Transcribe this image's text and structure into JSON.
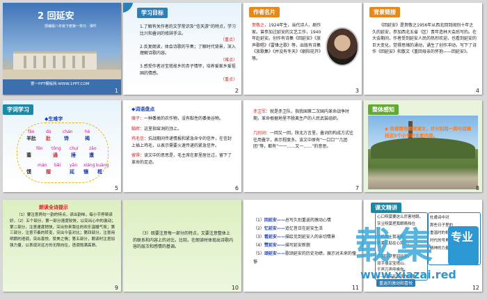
{
  "s1": {
    "title": "2 回延安",
    "caption": "部编版八年级下册第一单元 · 课件",
    "footer": "第一PPT模板网-WWW.1PPT.COM",
    "num": "1"
  },
  "s2": {
    "tag": "学习目标",
    "lines": [
      "1.了解有关作者的文学常识及“信天游”的特点，学习比兴和叠词的修辞手法。",
      "（重点）",
      "2.反复朗读，体会诗歌的节奏；了解时代背景，深入理解诗歌内容。",
      "（难点）",
      "3.感受作者对宝塔故乡的赤子情怀，培养爱家乡爱祖国的情感。",
      "（重点）"
    ],
    "num": "2"
  },
  "s3": {
    "tag": "作者名片",
    "name": "贺敬之，",
    "text": "1924年生，当代诗人、剧作家。曾参加过延安的文艺工作，1940年赴延安。创作有诗集《回延安》《放声歌唱》《雷锋之歌》等，出版有诗集《放歌集》《并没有冬天》《朝阳花开》等。",
    "num": "3"
  },
  "s4": {
    "tag": "背景链接",
    "text": "《回延安》是贺敬之1956年从西北回到阔别十年之久的延安，参加西北五省（区）青年造林大会后写的。在大会期间，作者受到延安人民的热烈欢迎，也看到延安的巨大变化，觉得思绪的涌动，诵生了创作冲动，写下了诗作《回延安》和散文《重回母亲的怀抱——回延安》。",
    "num": "4"
  },
  "s5": {
    "tag": "字词学习",
    "head": "◆生难字",
    "items": [
      {
        "py": "fǎo",
        "ch": "羊肚"
      },
      {
        "py": "dù",
        "ch": "肚"
      },
      {
        "py": "chán",
        "ch": "馋"
      },
      {
        "py": "hè",
        "ch": "褐"
      },
      {
        "py": "fēn",
        "ch": "蔫"
      },
      {
        "py": "tōnɡ",
        "ch": "通"
      },
      {
        "py": "chuí",
        "ch": "捶"
      },
      {
        "py": "zāo",
        "ch": "遭"
      },
      {
        "py": "mán",
        "ch": "馍"
      },
      {
        "py": "bǎi",
        "ch": "摆"
      },
      {
        "py": "yān",
        "ch": "延"
      },
      {
        "py": "xiánɡ",
        "ch": "镶"
      },
      {
        "py": "kuànɡ",
        "ch": "框"
      }
    ],
    "num": "5"
  },
  "s6": {
    "tag": "◆词语盘点",
    "items": [
      {
        "w": "糜子：",
        "d": "一种黍类的农作物，没有黏性的黍类谷物。"
      },
      {
        "w": "脑畔：",
        "d": "这里指窑洞的顶上。"
      },
      {
        "w": "鸡毛信：",
        "d": "抗战期间传递情报和紧急命令的信件，在信封上插上鸡毛，以表示需要火速传递的紧急信件。"
      },
      {
        "w": "留得：",
        "d": "读文中的意思是，毛主席在那里居住过，留下了革命的足迹。"
      }
    ],
    "num": "6"
  },
  "s7": {
    "items": [
      {
        "w": "赤卫军：",
        "d": "就是赤卫队，指我国第二次国内革命战争时期，革命根据地里不脱离生产的人民武装组织。"
      },
      {
        "w": "几则词：",
        "d": "一回又一回，陕北方言里，叠词的构成方式往往用叠字，表示程度多。该文中原有“一口口”“几团团”等，都有“一一……又一……”的意思。"
      }
    ],
    "num": "7"
  },
  "s8": {
    "tag": "整体感知",
    "line1": "◆ 有感情地朗读课文，并分别用一两句话概括这5个小节的主要内容。",
    "num": "8"
  },
  "s9": {
    "tag": "朗读全诗提示",
    "text": "（1）要注意两句一韵的特点，读出韵味，每小节停顿读好。（2）五个部分，第一部分速度较快，以突出心中的激动；第二部分，注意速度稍快，突出你来我往的欢乐温暖气氛；第三部分，注意节奏的转变，突出今昔对比；第四部分，注意用明朗的语调，突出喜悦、赞美之情；第五部分，朗读时注意加强力量，以表现对远方的无限向往，语调饱满高昂。",
    "num": "9"
  },
  "s10": {
    "text": "（3）既要注意每一部分的特点，又要注意整体上的联系和内容上的对比，比较。在朗读时体现出诗歌内容的层次和感情的基调。",
    "num": "10"
  },
  "s11": {
    "items": [
      {
        "a": "（1）",
        "b": "回延安——",
        "c": "总写久别重返的激动心情"
      },
      {
        "a": "（2）",
        "b": "忆延安——",
        "c": "追忆昔日在延安生活"
      },
      {
        "a": "（3）",
        "b": "看延安——",
        "c": "描绘见到延安人的亲切情景"
      },
      {
        "a": "（4）",
        "b": "赞延安——",
        "c": "描写延安新貌"
      },
      {
        "a": "（5）",
        "b": "颂延安——",
        "c": "歌颂延安的历史功绩，展示对未来的憧憬"
      }
    ],
    "num": "11"
  },
  "s12": {
    "tag": "课文精讲",
    "verse": [
      "心口呀莫要这么厉害地跳，",
      "灰尘呀莫把我眼睛挡住了……",
      "手抓黄土我不放，",
      "紧紧儿贴在心窝上。",
      "……",
      "几回回梦里回延安，",
      "双手搂定宝塔山。",
      "千声万声呼唤你，",
      "——母亲延安就在这里！"
    ],
    "right": [
      "杜甫诗中对",
      "那些日子里的",
      "重温时的相遇",
      "时代的号角",
      "精神的力量"
    ],
    "bottom": "重返的激动和喜悦",
    "num": "12"
  },
  "watermark": {
    "big1": "载",
    "big2": "集",
    "sub": "专业",
    "url": "www.xiazai.red"
  }
}
